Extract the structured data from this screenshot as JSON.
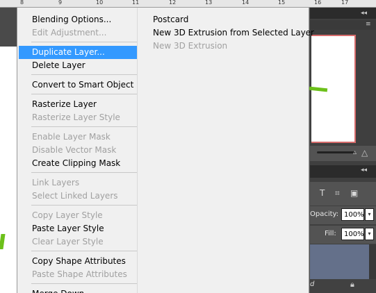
{
  "ruler": {
    "numbers": [
      "8",
      "9",
      "10",
      "11",
      "12",
      "13",
      "14",
      "15",
      "16",
      "17"
    ]
  },
  "layers_panel": {
    "opacity_label": "Opacity:",
    "opacity_value": "100%",
    "fill_label": "Fill:",
    "fill_value": "100%",
    "layer_name": "d"
  },
  "context_menu": {
    "items": [
      {
        "label": "Blending Options...",
        "enabled": true
      },
      {
        "label": "Edit Adjustment...",
        "enabled": false
      },
      {
        "label": "Duplicate Layer...",
        "enabled": true,
        "highlighted": true
      },
      {
        "label": "Delete Layer",
        "enabled": true
      },
      {
        "label": "Convert to Smart Object",
        "enabled": true
      },
      {
        "label": "Rasterize Layer",
        "enabled": true
      },
      {
        "label": "Rasterize Layer Style",
        "enabled": false
      },
      {
        "label": "Enable Layer Mask",
        "enabled": false
      },
      {
        "label": "Disable Vector Mask",
        "enabled": false
      },
      {
        "label": "Create Clipping Mask",
        "enabled": true
      },
      {
        "label": "Link Layers",
        "enabled": false
      },
      {
        "label": "Select Linked Layers",
        "enabled": false
      },
      {
        "label": "Copy Layer Style",
        "enabled": false
      },
      {
        "label": "Paste Layer Style",
        "enabled": true
      },
      {
        "label": "Clear Layer Style",
        "enabled": false
      },
      {
        "label": "Copy Shape Attributes",
        "enabled": true
      },
      {
        "label": "Paste Shape Attributes",
        "enabled": false
      },
      {
        "label": "Merge Down",
        "enabled": true
      }
    ]
  },
  "submenu": {
    "items": [
      {
        "label": "Postcard",
        "enabled": true
      },
      {
        "label": "New 3D Extrusion from Selected Layer",
        "enabled": true
      },
      {
        "label": "New 3D Extrusion",
        "enabled": false
      }
    ]
  },
  "colors": {
    "highlight": "#3399ff",
    "menu_bg": "#f0f0f0",
    "disabled_text": "#a0a0a0",
    "accent_green": "#6cc01a"
  }
}
